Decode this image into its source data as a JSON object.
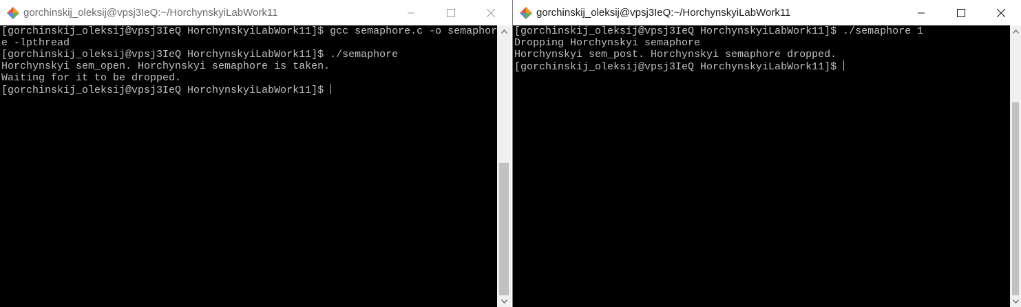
{
  "left_window": {
    "title": "gorchinskij_oleksij@vpsj3IeQ:~/HorchynskyiLabWork11",
    "icon": "putty-icon",
    "lines": [
      "[gorchinskij_oleksij@vpsj3IeQ HorchynskyiLabWork11]$ gcc semaphore.c -o semaphor",
      "e -lpthread",
      "[gorchinskij_oleksij@vpsj3IeQ HorchynskyiLabWork11]$ ./semaphore",
      "Horchynskyi sem_open. Horchynskyi semaphore is taken.",
      "Waiting for it to be dropped.",
      "[gorchinskij_oleksij@vpsj3IeQ HorchynskyiLabWork11]$ "
    ]
  },
  "right_window": {
    "title": "gorchinskij_oleksij@vpsj3IeQ:~/HorchynskyiLabWork11",
    "icon": "putty-icon",
    "lines": [
      "[gorchinskij_oleksij@vpsj3IeQ HorchynskyiLabWork11]$ ./semaphore 1",
      "Dropping Horchynskyi semaphore",
      "Horchynskyi sem_post. Horchynskyi semaphore dropped.",
      "[gorchinskij_oleksij@vpsj3IeQ HorchynskyiLabWork11]$ "
    ]
  },
  "colors": {
    "terminal_bg": "#000000",
    "terminal_fg": "#c0c0c0",
    "titlebar_bg": "#ffffff"
  }
}
